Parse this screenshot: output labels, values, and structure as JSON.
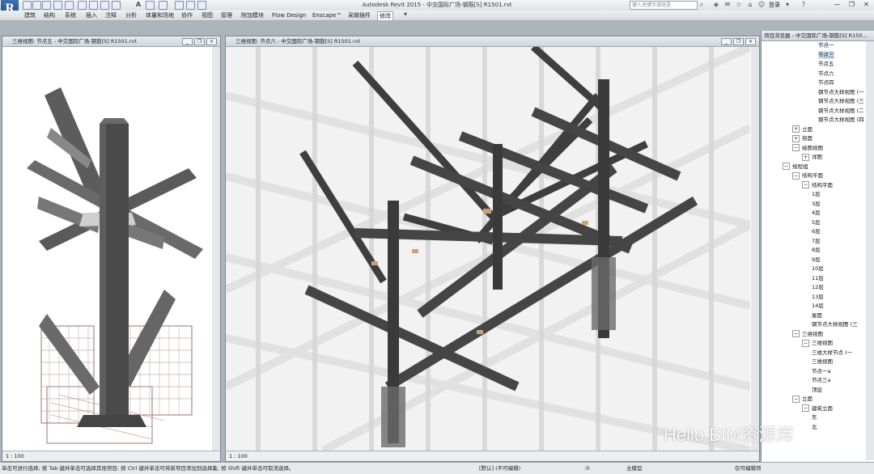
{
  "app": {
    "logo_letter": "R",
    "title": "Autodesk Revit 2015 -    中交国际广场-钢筋[S] R1501.rvt",
    "search_placeholder": "键入关键字或短语",
    "login": "登录"
  },
  "ribbon_tabs": [
    "建筑",
    "结构",
    "系统",
    "插入",
    "注释",
    "分析",
    "体量和场地",
    "协作",
    "视图",
    "管理",
    "附加模块",
    "Flow Design",
    "Enscape™",
    "采辑插件",
    "修改"
  ],
  "active_tab_index": 14,
  "views": [
    {
      "title": "三维视图: 节点五 - 中交国际广场-钢筋[S] R1501.rvt",
      "scale": "1 : 100"
    },
    {
      "title": "三维视图: 节点六 - 中交国际广场-钢筋[S] R1501.rvt",
      "scale": "1 : 100"
    }
  ],
  "browser": {
    "title": "项目浏览器 - 中交国际广场-钢筋[S] R150...",
    "items": [
      {
        "label": "节点一",
        "expander": "",
        "selected": false
      },
      {
        "label": "节点三",
        "expander": "",
        "selected": true
      },
      {
        "label": "节点五",
        "expander": "",
        "selected": false
      },
      {
        "label": "节点六",
        "expander": "",
        "selected": false
      },
      {
        "label": "节点四",
        "expander": "",
        "selected": false
      },
      {
        "label": "钢节点大样视图 (一",
        "expander": "",
        "selected": false
      },
      {
        "label": "钢节点大样视图 (三",
        "expander": "",
        "selected": false
      },
      {
        "label": "钢节点大样视图 (二",
        "expander": "",
        "selected": false
      },
      {
        "label": "钢节点大样视图 (四",
        "expander": "",
        "selected": false
      },
      {
        "label": "立面",
        "expander": "+",
        "selected": false
      },
      {
        "label": "剖面",
        "expander": "+",
        "selected": false
      },
      {
        "label": "绘图视图",
        "expander": "−",
        "selected": false
      },
      {
        "label": "详图",
        "expander": "+",
        "selected": false
      },
      {
        "label": "规程组",
        "expander": "−",
        "selected": false
      },
      {
        "label": "结构平面",
        "expander": "−",
        "selected": false
      },
      {
        "label": "结构平面",
        "expander": "−",
        "selected": false
      },
      {
        "label": "1层",
        "expander": "",
        "selected": false
      },
      {
        "label": "3层",
        "expander": "",
        "selected": false
      },
      {
        "label": "4层",
        "expander": "",
        "selected": false
      },
      {
        "label": "5层",
        "expander": "",
        "selected": false
      },
      {
        "label": "6层",
        "expander": "",
        "selected": false
      },
      {
        "label": "7层",
        "expander": "",
        "selected": false
      },
      {
        "label": "8层",
        "expander": "",
        "selected": false
      },
      {
        "label": "9层",
        "expander": "",
        "selected": false
      },
      {
        "label": "10层",
        "expander": "",
        "selected": false
      },
      {
        "label": "11层",
        "expander": "",
        "selected": false
      },
      {
        "label": "12层",
        "expander": "",
        "selected": false
      },
      {
        "label": "13层",
        "expander": "",
        "selected": false
      },
      {
        "label": "14层",
        "expander": "",
        "selected": false
      },
      {
        "label": "屋面",
        "expander": "",
        "selected": false
      },
      {
        "label": "钢节点大样视图 (三",
        "expander": "",
        "selected": false
      },
      {
        "label": "三维视图",
        "expander": "−",
        "selected": false
      },
      {
        "label": "三维视图",
        "expander": "−",
        "selected": false
      },
      {
        "label": "三维大样节点 (一",
        "expander": "",
        "selected": false
      },
      {
        "label": "三维视图",
        "expander": "",
        "selected": false
      },
      {
        "label": "节点一a",
        "expander": "",
        "selected": false
      },
      {
        "label": "节点三a",
        "expander": "",
        "selected": false
      },
      {
        "label": "顶层",
        "expander": "",
        "selected": false
      },
      {
        "label": "立面",
        "expander": "−",
        "selected": false
      },
      {
        "label": "建筑立面",
        "expander": "−",
        "selected": false
      },
      {
        "label": "东",
        "expander": "",
        "selected": false
      },
      {
        "label": "北",
        "expander": "",
        "selected": false
      }
    ]
  },
  "status": {
    "hint": "单击可进行选择; 按 Tab 键并单击可选择其他项目; 按 Ctrl 键并单击可将新项目添加到选择集; 按 Shift 键并单击可取消选择。",
    "workset": "[默认] (不可编辑)",
    "zero": ":0",
    "model": "主模型",
    "editable_only": "仅可编辑项"
  },
  "watermark": "Hello BIM资源库"
}
